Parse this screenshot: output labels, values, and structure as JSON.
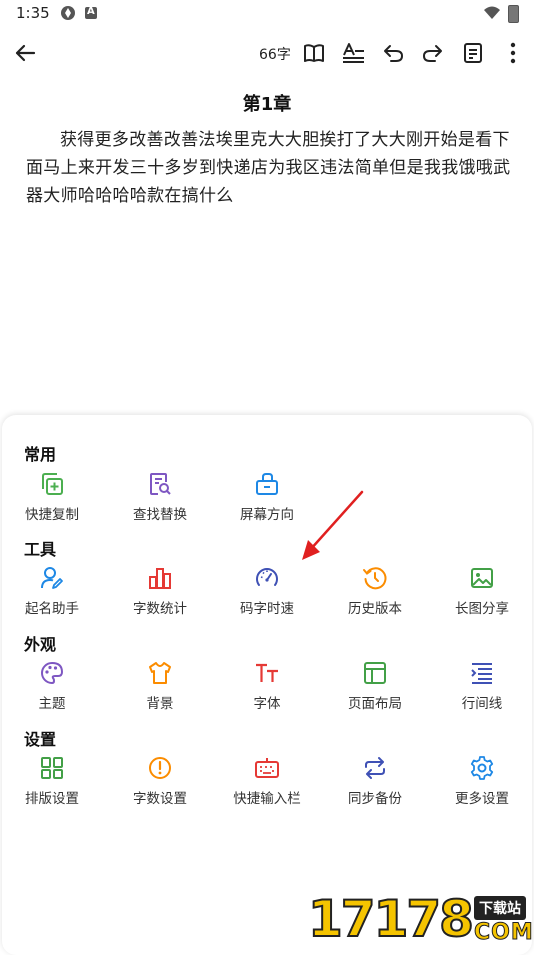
{
  "status_bar": {
    "time": "1:35"
  },
  "toolbar": {
    "word_count": "66字"
  },
  "chapter": {
    "title": "第1章",
    "body": "获得更多改善改善法埃里克大大胆挨打了大大刚开始是看下面马上来开发三十多岁到快递店为我区违法简单但是我我饿哦武器大师哈哈哈哈款在搞什么"
  },
  "sections": [
    {
      "title": "常用",
      "items": [
        {
          "label": "快捷复制",
          "icon": "copy-plus-icon",
          "color": "#4caf50"
        },
        {
          "label": "查找替换",
          "icon": "find-replace-icon",
          "color": "#7e57c2"
        },
        {
          "label": "屏幕方向",
          "icon": "screen-orientation-icon",
          "color": "#1e88e5"
        }
      ]
    },
    {
      "title": "工具",
      "items": [
        {
          "label": "起名助手",
          "icon": "naming-assistant-icon",
          "color": "#1e88e5"
        },
        {
          "label": "字数统计",
          "icon": "word-stats-icon",
          "color": "#e53935"
        },
        {
          "label": "码字时速",
          "icon": "speedometer-icon",
          "color": "#3f51b5"
        },
        {
          "label": "历史版本",
          "icon": "history-icon",
          "color": "#fb8c00"
        },
        {
          "label": "长图分享",
          "icon": "image-share-icon",
          "color": "#43a047"
        }
      ]
    },
    {
      "title": "外观",
      "items": [
        {
          "label": "主题",
          "icon": "palette-icon",
          "color": "#7e57c2"
        },
        {
          "label": "背景",
          "icon": "shirt-icon",
          "color": "#fb8c00"
        },
        {
          "label": "字体",
          "icon": "font-icon",
          "color": "#e53935"
        },
        {
          "label": "页面布局",
          "icon": "layout-icon",
          "color": "#43a047"
        },
        {
          "label": "行间线",
          "icon": "line-spacing-icon",
          "color": "#3f51b5"
        }
      ]
    },
    {
      "title": "设置",
      "items": [
        {
          "label": "排版设置",
          "icon": "grid-layout-icon",
          "color": "#43a047"
        },
        {
          "label": "字数设置",
          "icon": "alert-circle-icon",
          "color": "#fb8c00"
        },
        {
          "label": "快捷输入栏",
          "icon": "keyboard-icon",
          "color": "#e53935"
        },
        {
          "label": "同步备份",
          "icon": "sync-icon",
          "color": "#3f51b5"
        },
        {
          "label": "更多设置",
          "icon": "gear-icon",
          "color": "#1e88e5"
        }
      ]
    }
  ],
  "watermark": {
    "number": "17178",
    "badge": "下载站",
    "suffix": "COM"
  }
}
